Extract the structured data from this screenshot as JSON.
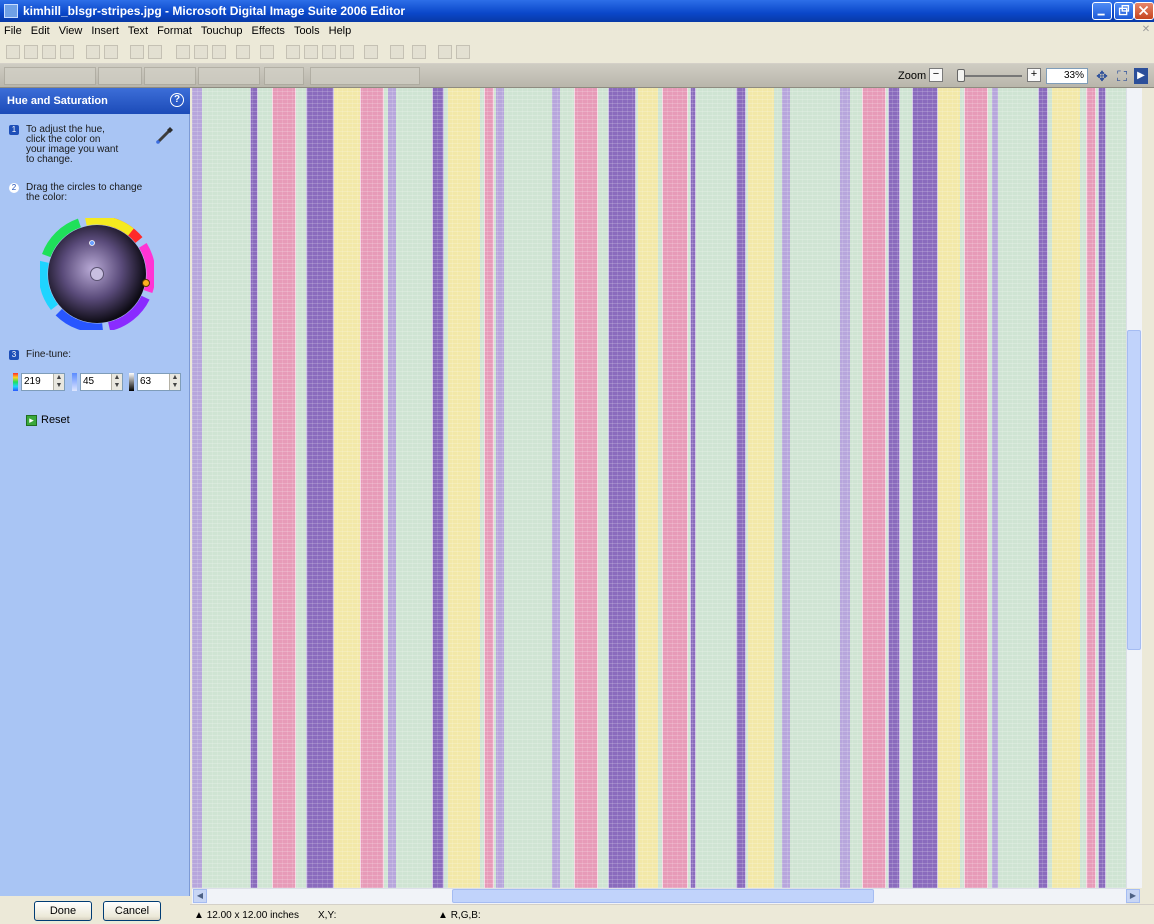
{
  "window": {
    "title": "kimhill_blsgr-stripes.jpg - Microsoft Digital Image Suite 2006 Editor"
  },
  "menu": [
    "File",
    "Edit",
    "View",
    "Insert",
    "Text",
    "Format",
    "Touchup",
    "Effects",
    "Tools",
    "Help"
  ],
  "toolbar2": {
    "zoom_label": "Zoom",
    "zoom_value": "33%",
    "zoom_slider_level": 0.05
  },
  "task_pane": {
    "title": "Hue and Saturation",
    "step1_num": "1",
    "step1_lines": [
      "To adjust the hue,",
      "click the color on",
      "your image you want",
      "to change."
    ],
    "step2_num": "2",
    "step2_lines": [
      "Drag the circles to change",
      "the color:"
    ],
    "step3_num": "3",
    "step3_label": "Fine-tune:",
    "fine_tune": {
      "hue": "219",
      "saturation": "45",
      "lightness": "63"
    },
    "reset_label": "Reset",
    "done_label": "Done",
    "cancel_label": "Cancel"
  },
  "status_bar": {
    "size": "12.00 x 12.00 inches",
    "xy": "X,Y:",
    "rgb": "R,G,B:"
  },
  "colors": {
    "green": "#cfe4d3",
    "pink": "#e79bb8",
    "purple": "#8a6bbd",
    "yellow": "#f2e8a8",
    "lavender": "#b7a6dc"
  }
}
